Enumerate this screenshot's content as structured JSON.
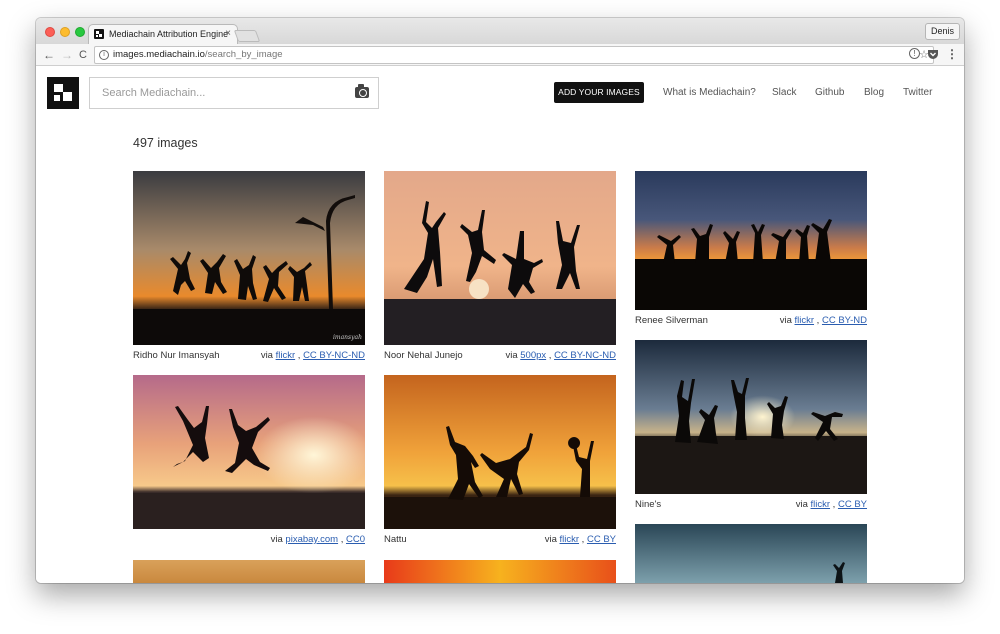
{
  "browser": {
    "tab_title": "Mediachain Attribution Engine",
    "tab_close": "×",
    "profile_name": "Denis",
    "url_host": "images.mediachain.io",
    "url_path": "/search_by_image",
    "nav_back": "←",
    "nav_forward": "→",
    "nav_reload": "C",
    "bookmark_star": "☆"
  },
  "header": {
    "search_placeholder": "Search Mediachain...",
    "add_button": "ADD YOUR IMAGES",
    "nav": [
      "What is Mediachain?",
      "Slack",
      "Github",
      "Blog",
      "Twitter"
    ]
  },
  "results": {
    "count_label": "497 images",
    "via_word": "via",
    "separator": ",",
    "items": [
      {
        "author": "Ridho Nur Imansyah",
        "source": "flickr",
        "license": "CC BY-NC-ND",
        "watermark": "imansyah"
      },
      {
        "author": "Noor Nehal Junejo",
        "source": "500px",
        "license": "CC BY-NC-ND"
      },
      {
        "author": "Renee Silverman",
        "source": "flickr",
        "license": "CC BY-ND"
      },
      {
        "author": "",
        "source": "pixabay.com",
        "license": "CC0"
      },
      {
        "author": "Nattu",
        "source": "flickr",
        "license": "CC BY"
      },
      {
        "author": "Nine's",
        "source": "flickr",
        "license": "CC BY"
      }
    ]
  },
  "colors": {
    "accent_button": "#111111",
    "link": "#2a5db0",
    "traffic_red": "#fc5f57",
    "traffic_yellow": "#fdbc2e",
    "traffic_green": "#28c840"
  },
  "icons": [
    "mediachain-logo-icon",
    "camera-icon",
    "info-icon",
    "star-icon",
    "shield-icon",
    "pocket-icon",
    "menu-icon"
  ]
}
